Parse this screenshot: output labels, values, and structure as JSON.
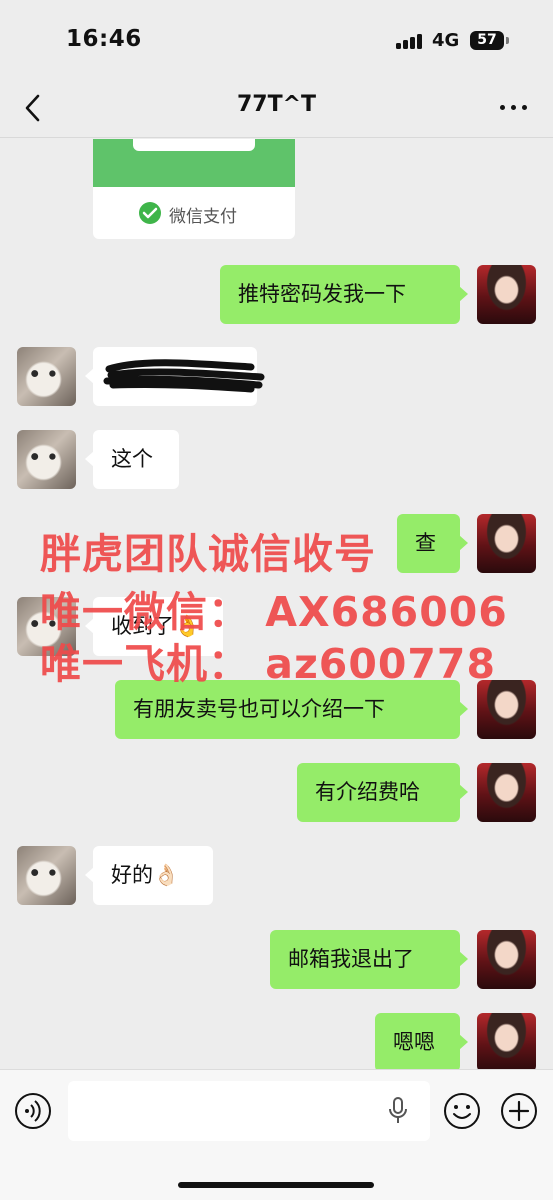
{
  "status_bar": {
    "time": "16:46",
    "network": "4G",
    "battery": "57"
  },
  "nav": {
    "title": "77T^T"
  },
  "pay_card": {
    "label": "微信支付"
  },
  "messages": [
    {
      "side": "out",
      "text": "推特密码发我一下"
    },
    {
      "side": "in",
      "text": "",
      "redacted": true
    },
    {
      "side": "in",
      "text": "这个"
    },
    {
      "side": "out",
      "text": "查"
    },
    {
      "side": "in",
      "text": "收到了👌"
    },
    {
      "side": "out",
      "text": "有朋友卖号也可以介绍一下"
    },
    {
      "side": "out",
      "text": "有介绍费哈"
    },
    {
      "side": "in",
      "text": "好的👌🏻"
    },
    {
      "side": "out",
      "text": "邮箱我退出了"
    },
    {
      "side": "out",
      "text": "嗯嗯"
    }
  ],
  "overlay": {
    "line1": "胖虎团队诚信收号",
    "line2": "唯一微信： AX686006",
    "line3": "唯一飞机： az600778"
  },
  "colors": {
    "background": "#ededed",
    "outgoing_bubble": "#95ec69",
    "incoming_bubble": "#ffffff",
    "overlay_text": "#ef4b4b",
    "wechat_green": "#5fc36a"
  },
  "icons": {
    "back": "back-chevron-icon",
    "more": "more-dots-icon",
    "voice": "voice-icon",
    "mic": "mic-icon",
    "emoji": "emoji-icon",
    "plus": "plus-icon"
  }
}
